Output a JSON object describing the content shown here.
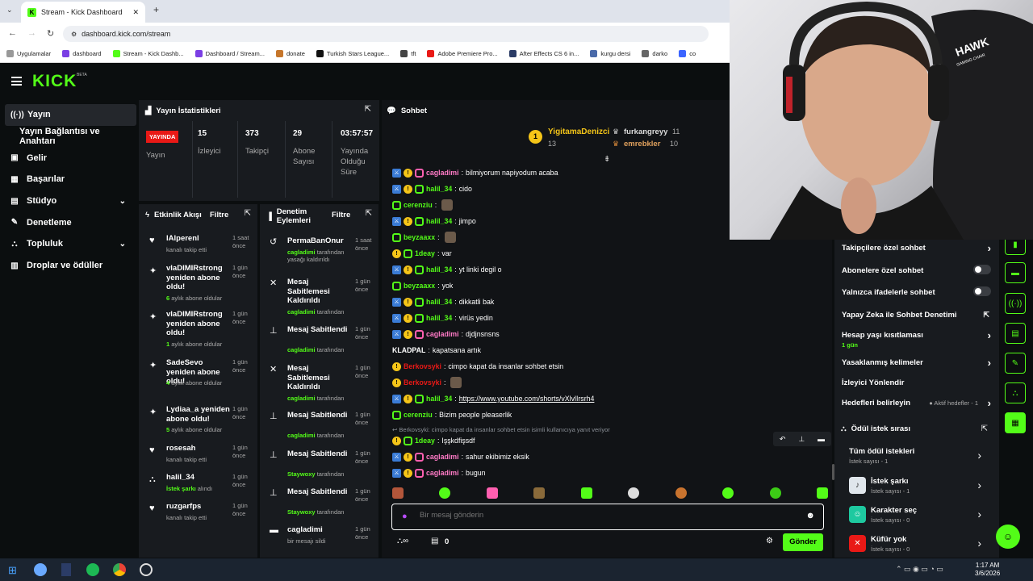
{
  "browser": {
    "tab_title": "Stream - Kick Dashboard",
    "url": "dashboard.kick.com/stream",
    "bookmarks": [
      "Uygulamalar",
      "dashboard",
      "Stream - Kick Dashb...",
      "Dashboard / Stream...",
      "donate",
      "Turkish Stars League...",
      "tft",
      "Adobe Premiere Pro...",
      "After Effects CS 6 in...",
      "kurgu dersi",
      "darko",
      "co"
    ]
  },
  "header": {
    "logo": "KICK",
    "beta": "BETA"
  },
  "sidebar": {
    "items": [
      {
        "label": "Yayın",
        "icon": "broadcast-icon"
      },
      {
        "label": "Yayın Bağlantısı ve Anahtarı",
        "icon": ""
      },
      {
        "label": "Gelir",
        "icon": "wallet-icon"
      },
      {
        "label": "Başarılar",
        "icon": "trophy-icon"
      },
      {
        "label": "Stüdyo",
        "icon": "studio-icon"
      },
      {
        "label": "Denetleme",
        "icon": "wrench-icon"
      },
      {
        "label": "Topluluk",
        "icon": "community-icon"
      },
      {
        "label": "Droplar ve ödüller",
        "icon": "gift-icon"
      }
    ]
  },
  "stats": {
    "title": "Yayın İstatistikleri",
    "live_badge": "YAYINDA",
    "live_label": "Yayın",
    "viewers": {
      "value": "15",
      "label": "İzleyici"
    },
    "followers": {
      "value": "373",
      "label": "Takipçi"
    },
    "subs": {
      "value": "29",
      "label": "Abone Sayısı"
    },
    "uptime": {
      "value": "03:57:57",
      "label": "Yayında Olduğu Süre"
    }
  },
  "activity": {
    "title": "Etkinlik Akışı",
    "filter": "Filtre",
    "items": [
      {
        "title": "lAlperenl",
        "time": "1 saat önce",
        "sub_pre": "",
        "sub": "kanalı takip etti"
      },
      {
        "title": "vlaDIMIRstrong yeniden abone oldu!",
        "time": "1 gün önce",
        "sub_pre": "6",
        "sub": "aylık abone oldular"
      },
      {
        "title": "vlaDIMIRstrong yeniden abone oldu!",
        "time": "1 gün önce",
        "sub_pre": "1",
        "sub": "aylık abone oldular"
      },
      {
        "title": "SadeSevo yeniden abone oldu!",
        "time": "1 gün önce",
        "sub_pre": "4",
        "sub": "aylık abone oldular"
      },
      {
        "title": "Lydiaa_a yeniden abone oldu!",
        "time": "1 gün önce",
        "sub_pre": "5",
        "sub": "aylık abone oldular"
      },
      {
        "title": "rosesah",
        "time": "1 gün önce",
        "sub_pre": "",
        "sub": "kanalı takip etti"
      },
      {
        "title": "halil_34",
        "time": "1 gün önce",
        "sub_pre": "İstek şarkı",
        "sub": "alındı"
      },
      {
        "title": "ruzgarfps",
        "time": "1 gün önce",
        "sub_pre": "",
        "sub": "kanalı takip etti"
      }
    ]
  },
  "moderation": {
    "title": "Denetim Eylemleri",
    "filter": "Filtre",
    "items": [
      {
        "title": "PermaBanOnur",
        "time": "1 saat önce",
        "by": "cagladimi",
        "sub": "tarafından yasağı kaldırıldı"
      },
      {
        "title": "Mesaj Sabitlemesi Kaldırıldı",
        "time": "1 gün önce",
        "by": "cagladimi",
        "sub": "tarafından"
      },
      {
        "title": "Mesaj Sabitlendi",
        "time": "1 gün önce",
        "by": "cagladimi",
        "sub": "tarafından"
      },
      {
        "title": "Mesaj Sabitlemesi Kaldırıldı",
        "time": "1 gün önce",
        "by": "cagladimi",
        "sub": "tarafından"
      },
      {
        "title": "Mesaj Sabitlendi",
        "time": "1 gün önce",
        "by": "cagladimi",
        "sub": "tarafından"
      },
      {
        "title": "Mesaj Sabitlendi",
        "time": "1 gün önce",
        "by": "Staywoxy",
        "sub": "tarafından"
      },
      {
        "title": "Mesaj Sabitlendi",
        "time": "1 gün önce",
        "by": "Staywoxy",
        "sub": "tarafından"
      },
      {
        "title": "cagladimi",
        "time": "1 gün önce",
        "by": "",
        "sub": "bir mesajı sildi"
      }
    ]
  },
  "chat": {
    "title": "Sohbet",
    "top_gifters": [
      {
        "name": "YigitamaDenizci",
        "count": "13"
      },
      {
        "name": "furkangreyy",
        "count": "11"
      },
      {
        "name": "emrebkler",
        "count": "10"
      }
    ],
    "messages": [
      {
        "user": "cagladimi",
        "text": "bilmiyorum napiyodum acaba",
        "color": "#ff7ac6"
      },
      {
        "user": "halil_34",
        "text": "cido",
        "color": "#53fc18"
      },
      {
        "user": "cerenziu",
        "text": "",
        "color": "#53fc18"
      },
      {
        "user": "halil_34",
        "text": "jimpo",
        "color": "#53fc18"
      },
      {
        "user": "beyzaaxx",
        "text": "",
        "color": "#53fc18"
      },
      {
        "user": "1deay",
        "text": "var",
        "color": "#53fc18"
      },
      {
        "user": "halil_34",
        "text": "yt linki degil o",
        "color": "#53fc18"
      },
      {
        "user": "beyzaaxx",
        "text": "yok",
        "color": "#53fc18"
      },
      {
        "user": "halil_34",
        "text": "dikkatli bak",
        "color": "#53fc18"
      },
      {
        "user": "halil_34",
        "text": "virüs yedin",
        "color": "#53fc18"
      },
      {
        "user": "cagladimi",
        "text": "djdjnsnsns",
        "color": "#ff7ac6"
      },
      {
        "user": "KLADPAL",
        "text": "kapatsana artık",
        "color": "#ffffff"
      },
      {
        "user": "Berkovsyki",
        "text": "cimpo kapat da insanlar sohbet etsin",
        "color": "#e91916"
      },
      {
        "user": "Berkovsyki",
        "text": "",
        "color": "#e91916"
      },
      {
        "user": "halil_34",
        "text": "https://www.youtube.com/shorts/vXlvlIrsrh4",
        "color": "#53fc18"
      },
      {
        "user": "cerenziu",
        "text": "Bizim people pleaserlik",
        "color": "#53fc18"
      }
    ],
    "reply_preview": "Berkovsyki: cimpo kapat da insanlar sohbet etsin isimli kullanıcıya yanıt veriyor",
    "messages_after": [
      {
        "user": "1deay",
        "text": "Işşkdfişsdf",
        "color": "#53fc18"
      },
      {
        "user": "cagladimi",
        "text": "sahur ekibimiz eksik",
        "color": "#ff7ac6"
      },
      {
        "user": "cagladimi",
        "text": "bugun",
        "color": "#ff7ac6"
      }
    ],
    "input_placeholder": "Bir mesaj gönderin",
    "points": "0",
    "send": "Gönder"
  },
  "settings": {
    "items": [
      {
        "label": "Takipçilere özel sohbet",
        "control": "chevron"
      },
      {
        "label": "Abonelere özel sohbet",
        "control": "toggle"
      },
      {
        "label": "Yalnızca ifadelerle sohbet",
        "control": "toggle"
      },
      {
        "label": "Yapay Zeka ile Sohbet Denetimi",
        "control": "external"
      },
      {
        "label": "Hesap yaşı kısıtlaması",
        "sub": "1 gün",
        "control": "chevron"
      },
      {
        "label": "Yasaklanmış kelimeler",
        "control": "chevron"
      },
      {
        "label": "İzleyici Yönlendir",
        "control": ""
      },
      {
        "label": "Hedefleri belirleyin",
        "extra": "Aktif hedefler - 1",
        "control": "chevron"
      }
    ]
  },
  "rewards": {
    "title": "Ödül istek sırası",
    "items": [
      {
        "label": "Tüm ödül istekleri",
        "sub": "İstek sayısı - 1"
      },
      {
        "label": "İstek şarkı",
        "sub": "İstek sayısı - 1"
      },
      {
        "label": "Karakter seç",
        "sub": "İstek sayısı - 0"
      },
      {
        "label": "Küfür yok",
        "sub": "İstek sayısı - 0"
      }
    ]
  },
  "taskbar": {
    "time": "1:17 AM",
    "date": "3/6/2026"
  },
  "webcam": {
    "logo_text": "HAWK",
    "logo_sub": "GAMING CHAIR"
  }
}
